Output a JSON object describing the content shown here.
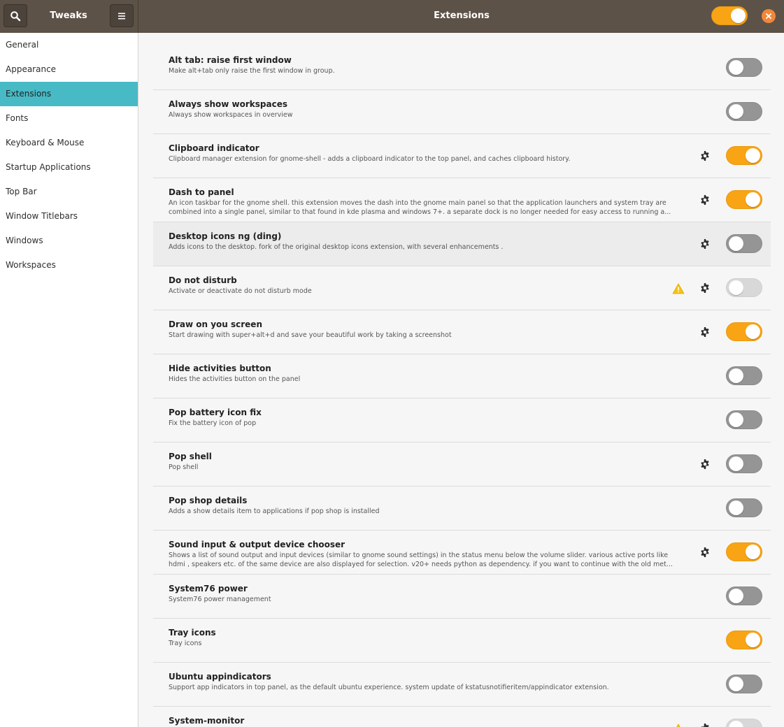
{
  "header": {
    "app_title": "Tweaks",
    "page_title": "Extensions",
    "master_switch_on": true,
    "icons": {
      "search": "search-icon",
      "menu": "hamburger-menu-icon",
      "close": "close-icon"
    },
    "colors": {
      "headerbar": "#5d5247",
      "accent": "#f9a414",
      "close": "#f0873b",
      "selection": "#47bac6"
    }
  },
  "sidebar": {
    "items": [
      {
        "label": "General",
        "selected": false
      },
      {
        "label": "Appearance",
        "selected": false
      },
      {
        "label": "Extensions",
        "selected": true
      },
      {
        "label": "Fonts",
        "selected": false
      },
      {
        "label": "Keyboard & Mouse",
        "selected": false
      },
      {
        "label": "Startup Applications",
        "selected": false
      },
      {
        "label": "Top Bar",
        "selected": false
      },
      {
        "label": "Window Titlebars",
        "selected": false
      },
      {
        "label": "Windows",
        "selected": false
      },
      {
        "label": "Workspaces",
        "selected": false
      }
    ]
  },
  "extensions": [
    {
      "name": "Alt tab: raise first window",
      "description": "Make alt+tab only raise the first window in group.",
      "enabled": false,
      "settings": false,
      "warning": false
    },
    {
      "name": "Always show workspaces",
      "description": "Always show workspaces in overview",
      "enabled": false,
      "settings": false,
      "warning": false
    },
    {
      "name": "Clipboard indicator",
      "description": "Clipboard manager extension for gnome-shell - adds a clipboard indicator to the top panel, and caches clipboard history.",
      "enabled": true,
      "settings": true,
      "warning": false
    },
    {
      "name": "Dash to panel",
      "description": "An icon taskbar for the gnome shell. this extension moves the dash into the gnome main panel so that the application launchers and system tray are combined into a single panel, similar to that found in kde plasma and windows 7+. a separate dock is no longer needed for easy access to running a...",
      "enabled": true,
      "settings": true,
      "warning": false
    },
    {
      "name": "Desktop icons ng (ding)",
      "description": "Adds icons to the desktop. fork of the original desktop icons extension, with several enhancements .",
      "enabled": false,
      "settings": true,
      "warning": false,
      "hover": true
    },
    {
      "name": "Do not disturb",
      "description": "Activate or deactivate do not disturb mode",
      "enabled": false,
      "settings": true,
      "warning": true,
      "disabled": true
    },
    {
      "name": "Draw on you screen",
      "description": "Start drawing with super+alt+d and save your beautiful work by taking a screenshot",
      "enabled": true,
      "settings": true,
      "warning": false
    },
    {
      "name": "Hide activities button",
      "description": "Hides the activities button on the panel",
      "enabled": false,
      "settings": false,
      "warning": false
    },
    {
      "name": "Pop battery icon fix",
      "description": "Fix the battery icon of pop",
      "enabled": false,
      "settings": false,
      "warning": false
    },
    {
      "name": "Pop shell",
      "description": "Pop shell",
      "enabled": false,
      "settings": true,
      "warning": false
    },
    {
      "name": "Pop shop details",
      "description": "Adds a show details item to applications if pop shop is installed",
      "enabled": false,
      "settings": false,
      "warning": false
    },
    {
      "name": "Sound input & output device chooser",
      "description": "Shows a list of sound output and input devices (similar to gnome sound settings) in the status menu below the volume slider. various active ports like hdmi , speakers etc. of the same device are also displayed for selection. v20+ needs python as dependency. if you want to continue with the old met...",
      "enabled": true,
      "settings": true,
      "warning": false
    },
    {
      "name": "System76 power",
      "description": "System76 power management",
      "enabled": false,
      "settings": false,
      "warning": false
    },
    {
      "name": "Tray icons",
      "description": "Tray icons",
      "enabled": true,
      "settings": false,
      "warning": false
    },
    {
      "name": "Ubuntu appindicators",
      "description": "Support app indicators in top panel, as the default ubuntu experience. system update of kstatusnotifieritem/appindicator extension.",
      "enabled": false,
      "settings": false,
      "warning": false
    },
    {
      "name": "System-monitor",
      "description": "",
      "enabled": false,
      "settings": true,
      "warning": true,
      "disabled": true
    }
  ]
}
